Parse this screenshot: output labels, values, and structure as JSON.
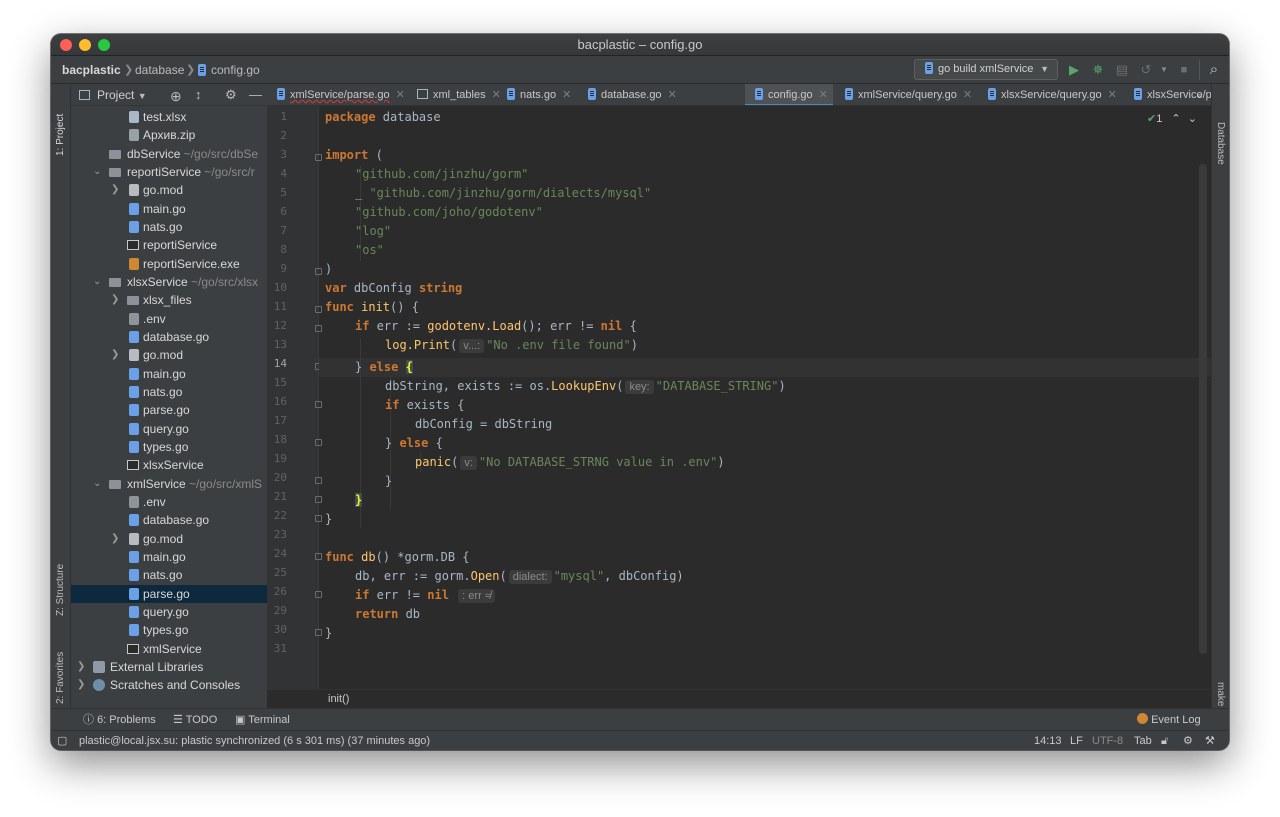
{
  "window": {
    "title": "bacplastic – config.go"
  },
  "breadcrumbs": {
    "project": "bacplastic",
    "folder": "database",
    "file": "config.go"
  },
  "run_config": {
    "label": "go build xmlService"
  },
  "project_panel": {
    "title": "Project"
  },
  "left_strip": {
    "project": "1: Project",
    "structure": "Z: Structure",
    "favorites": "2: Favorites"
  },
  "right_strip": {
    "database": "Database",
    "make": "make"
  },
  "tabs": [
    {
      "label": "xmlService/parse.go"
    },
    {
      "label": "xml_tables"
    },
    {
      "label": "nats.go"
    },
    {
      "label": "database.go"
    },
    {
      "label": "config.go"
    },
    {
      "label": "xmlService/query.go"
    },
    {
      "label": "xlsxService/query.go"
    },
    {
      "label": "xlsxService/parse."
    }
  ],
  "tree": [
    {
      "name": "test.xlsx"
    },
    {
      "name": "Архив.zip"
    },
    {
      "name": "dbService",
      "path": "~/go/src/dbSe"
    },
    {
      "name": "reportiService",
      "path": "~/go/src/r"
    },
    {
      "name": "go.mod"
    },
    {
      "name": "main.go"
    },
    {
      "name": "nats.go"
    },
    {
      "name": "reportiService"
    },
    {
      "name": "reportiService.exe"
    },
    {
      "name": "xlsxService",
      "path": "~/go/src/xlsx"
    },
    {
      "name": "xlsx_files"
    },
    {
      "name": ".env"
    },
    {
      "name": "database.go"
    },
    {
      "name": "go.mod"
    },
    {
      "name": "main.go"
    },
    {
      "name": "nats.go"
    },
    {
      "name": "parse.go"
    },
    {
      "name": "query.go"
    },
    {
      "name": "types.go"
    },
    {
      "name": "xlsxService"
    },
    {
      "name": "xmlService",
      "path": "~/go/src/xmlS"
    },
    {
      "name": ".env"
    },
    {
      "name": "database.go"
    },
    {
      "name": "go.mod"
    },
    {
      "name": "main.go"
    },
    {
      "name": "nats.go"
    },
    {
      "name": "parse.go"
    },
    {
      "name": "query.go"
    },
    {
      "name": "types.go"
    },
    {
      "name": "xmlService"
    },
    {
      "name": "External Libraries"
    },
    {
      "name": "Scratches and Consoles"
    }
  ],
  "code": {
    "line_numbers": [
      "1",
      "2",
      "3",
      "4",
      "5",
      "6",
      "7",
      "8",
      "9",
      "10",
      "11",
      "12",
      "13",
      "14",
      "15",
      "16",
      "17",
      "18",
      "19",
      "20",
      "21",
      "22",
      "23",
      "24",
      "25",
      "26",
      "29",
      "30",
      "31"
    ],
    "t": {
      "package": "package",
      "database": " database",
      "import": "import",
      "paren_open": " (",
      "imp1": "\"github.com/jinzhu/gorm\"",
      "imp2_prefix": "_ ",
      "imp2": "\"github.com/jinzhu/gorm/dialects/mysql\"",
      "imp3": "\"github.com/joho/godotenv\"",
      "imp4": "\"log\"",
      "imp5": "\"os\"",
      "paren_close": ")",
      "var": "var",
      "dbconfig_decl": " dbConfig ",
      "string_type": "string",
      "func": "func",
      "init": " init",
      "init_sig": "() {",
      "if": "if",
      "err_assign": " err := ",
      "godotenv_load": "godotenv.Load",
      "load_rest": "(); err != ",
      "nil": "nil",
      "open_brace": " {",
      "log_print": "log.Print",
      "paren": "(",
      "hint_v": "v...:",
      "no_env": "\"No .env file found\"",
      "close_paren": ")",
      "close_brace": "} ",
      "else": "else",
      "brace_hl": "{",
      "dbstring_assign": "dbString, exists := os.",
      "lookupenv": "LookupEnv",
      "hint_key": "key:",
      "db_string": "\"DATABASE_STRING\"",
      "if_exists": " exists {",
      "dbconfig_assign": "dbConfig = dbString",
      "else_brace": " {",
      "panic": "panic",
      "hint_v2": "v:",
      "panic_msg": "\"No DATABASE_STRNG value in .env\"",
      "brace": "}",
      "db_func": " db",
      "db_sig_open": "() *gorm.",
      "db_type": "DB",
      "db_sig_close": " {",
      "db_assign": "db, err := gorm.",
      "gorm_open": "Open",
      "hint_dialect": "dialect:",
      "mysql": "\"mysql\"",
      "dbconfig_arg": ", dbConfig)",
      "err_neq": " err != ",
      "hint_err": ": err ≉",
      "return": "return",
      "return_db": " db"
    }
  },
  "editor_breadcrumb": "init()",
  "inspection": {
    "count": "1"
  },
  "bottom_toolbar": {
    "problems": "6: Problems",
    "todo": "TODO",
    "terminal": "Terminal",
    "event_log": "Event Log"
  },
  "status": {
    "message": "plastic@local.jsx.su: plastic synchronized (6 s 301 ms) (37 minutes ago)",
    "position": "14:13",
    "line_sep": "LF",
    "encoding": "UTF-8",
    "indent": "Tab"
  },
  "icons": [
    "folder-icon",
    "go-file-icon",
    "run-icon",
    "debug-icon",
    "search-icon",
    "gear-icon",
    "close-icon",
    "chevron-down-icon",
    "chevron-right-icon",
    "lock-icon",
    "wrench-icon"
  ],
  "colors": {
    "keyword": "#cc7832",
    "string": "#6a8759",
    "function": "#ffc66d",
    "text": "#a9b7c6",
    "accent": "#4a88c7"
  }
}
